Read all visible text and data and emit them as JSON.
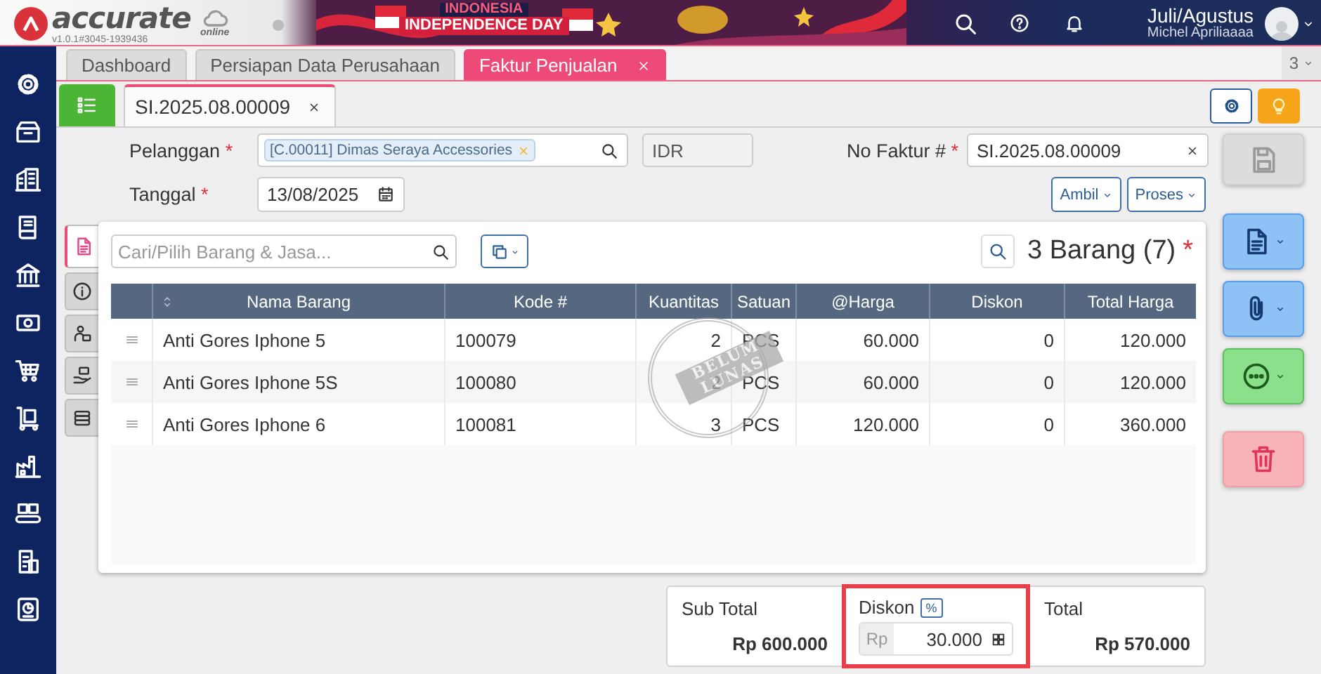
{
  "app": {
    "logo": "accurate",
    "logo_sub": "online",
    "version": "v1.0.1#3045-1939436"
  },
  "banner": {
    "line1": "INDONESIA",
    "line2": "INDEPENDENCE DAY"
  },
  "user": {
    "period": "Juli/Agustus",
    "name": "Michel Apriliaaaa"
  },
  "tabs": [
    {
      "label": "Dashboard",
      "selected": false,
      "closable": false
    },
    {
      "label": "Persiapan Data Perusahaan",
      "selected": false,
      "closable": false
    },
    {
      "label": "Faktur Penjualan",
      "selected": true,
      "closable": true
    }
  ],
  "tab_overflow": "3",
  "doc_tabs": [
    {
      "label": "SI.2025.08.00009",
      "selected": true,
      "closable": true
    }
  ],
  "form": {
    "customer": {
      "label": "Pelanggan",
      "mark": "*",
      "value": "[C.00011] Dimas Seraya Accessories"
    },
    "currency": {
      "value": "IDR",
      "disabled": true
    },
    "invoice_no": {
      "label": "No Faktur #",
      "mark": "*",
      "value": "SI.2025.08.00009"
    },
    "date": {
      "label": "Tanggal",
      "mark": "*",
      "value": "13/08/2025"
    },
    "buttons": [
      "Ambil",
      "Proses"
    ]
  },
  "side_tabs": [
    {
      "selected": true
    },
    {
      "selected": false
    },
    {
      "selected": false
    },
    {
      "selected": false
    },
    {
      "selected": false
    }
  ],
  "items": {
    "search_placeholder": "Cari/Pilih Barang & Jasa...",
    "count": "3 Barang (7)",
    "count_mark": "*",
    "columns": [
      "Nama Barang",
      "Kode #",
      "Kuantitas",
      "Satuan",
      "@Harga",
      "Diskon",
      "Total Harga"
    ],
    "rows": [
      [
        "Anti Gores Iphone 5",
        "100079",
        "2",
        "PCS",
        "60.000",
        "0",
        "120.000"
      ],
      [
        "Anti Gores Iphone 5S",
        "100080",
        "2",
        "PCS",
        "60.000",
        "0",
        "120.000"
      ],
      [
        "Anti Gores Iphone 6",
        "100081",
        "3",
        "PCS",
        "120.000",
        "0",
        "360.000"
      ]
    ],
    "stamp": "BELUM LUNAS"
  },
  "totals": {
    "subtotal": {
      "label": "Sub Total",
      "value": "Rp 600.000"
    },
    "discount": {
      "label": "Diskon",
      "badge": "%",
      "prefix": "Rp",
      "value": "30.000",
      "highlighted": true
    },
    "total": {
      "label": "Total",
      "value": "Rp 570.000"
    }
  },
  "actions": [
    {
      "kind": "save",
      "disabled": true
    },
    {
      "kind": "document",
      "disabled": false
    },
    {
      "kind": "attachment",
      "disabled": false
    },
    {
      "kind": "more",
      "disabled": false
    },
    {
      "kind": "delete",
      "disabled": false
    }
  ]
}
